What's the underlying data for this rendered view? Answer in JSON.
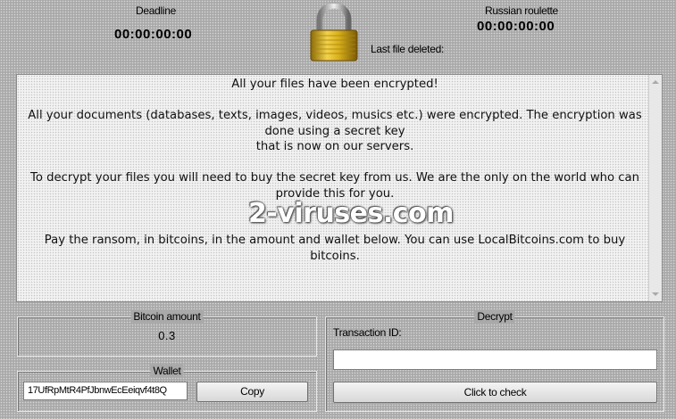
{
  "header": {
    "deadline_label": "Deadline",
    "deadline_timer": "00:00:00:00",
    "roulette_label": "Russian roulette",
    "roulette_timer": "00:00:00:00",
    "last_file_label": "Last file deleted:"
  },
  "message": {
    "p1": "All your files have been encrypted!",
    "p2": "All your documents (databases, texts, images, videos, musics etc.) were encrypted. The encryption was done using a secret key",
    "p2b": "that is now on our servers.",
    "p3": "To decrypt your files you will need to buy the secret key from us. We are the only on the world who can provide this for you.",
    "p4": "Pay the ransom, in bitcoins, in the amount and wallet below. You can use LocalBitcoins.com to buy bitcoins."
  },
  "watermark": "2-viruses.com",
  "bitcoin": {
    "title": "Bitcoin amount",
    "amount": "0.3"
  },
  "wallet": {
    "title": "Wallet",
    "address": "17UfRpMtR4PfJbnwEcEeiqvf4t8Q",
    "copy_label": "Copy"
  },
  "decrypt": {
    "title": "Decrypt",
    "txid_label": "Transaction ID:",
    "txid_value": "",
    "check_label": "Click to check"
  },
  "colors": {
    "background": "#a9a9a9",
    "lock_gold": "#d9b01c"
  },
  "icons": {
    "lock": "padlock-icon"
  }
}
